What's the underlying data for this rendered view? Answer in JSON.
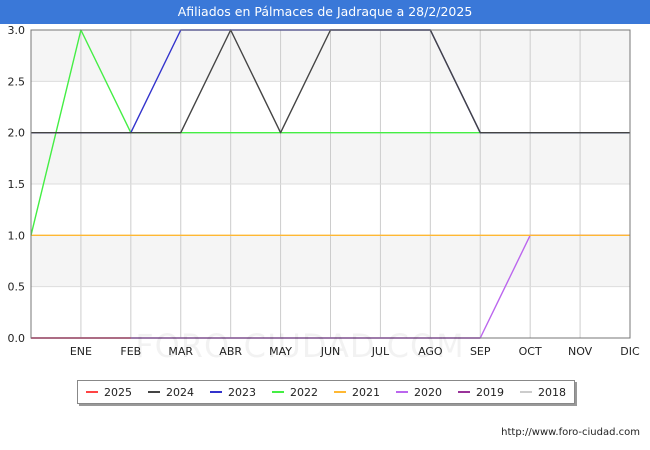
{
  "header": {
    "title": "Afiliados en Pálmaces de Jadraque a 28/2/2025"
  },
  "footer": {
    "url": "http://www.foro-ciudad.com"
  },
  "watermark": {
    "text": "FORO-CIUDAD.COM"
  },
  "chart_data": {
    "type": "line",
    "title": "Afiliados en Pálmaces de Jadraque a 28/2/2025",
    "xlabel": "",
    "ylabel": "",
    "categories": [
      "",
      "ENE",
      "FEB",
      "MAR",
      "ABR",
      "MAY",
      "JUN",
      "JUL",
      "AGO",
      "SEP",
      "OCT",
      "NOV",
      "DIC"
    ],
    "ylim": [
      0,
      3
    ],
    "yticks": [
      "0.0",
      "0.5",
      "1.0",
      "1.5",
      "2.0",
      "2.5",
      "3.0"
    ],
    "grid": true,
    "legend_position": "bottom",
    "series": [
      {
        "name": "2025",
        "color": "#ff4444",
        "values": [
          0,
          0,
          0
        ]
      },
      {
        "name": "2024",
        "color": "#444444",
        "values": [
          2,
          2,
          2,
          2,
          3,
          2,
          3,
          3,
          3,
          2,
          2,
          2,
          2
        ]
      },
      {
        "name": "2023",
        "color": "#3333cc",
        "values": [
          2,
          2,
          2,
          3,
          3,
          3,
          3,
          3,
          3,
          2,
          2,
          2,
          2
        ]
      },
      {
        "name": "2022",
        "color": "#44ee44",
        "values": [
          1,
          3,
          2,
          2,
          2,
          2,
          2,
          2,
          2,
          2,
          2,
          2,
          2
        ]
      },
      {
        "name": "2021",
        "color": "#ffb833",
        "values": [
          1,
          1,
          1,
          1,
          1,
          1,
          1,
          1,
          1,
          1,
          1,
          1,
          1
        ]
      },
      {
        "name": "2020",
        "color": "#bb66ee",
        "values": [
          0,
          0,
          0,
          0,
          0,
          0,
          0,
          0,
          0,
          0,
          1,
          1,
          1
        ]
      },
      {
        "name": "2019",
        "color": "#993399",
        "values": [
          0,
          0,
          0,
          0,
          0,
          0,
          0,
          0,
          0,
          0
        ]
      },
      {
        "name": "2018",
        "color": "#cccccc",
        "values": []
      }
    ]
  }
}
